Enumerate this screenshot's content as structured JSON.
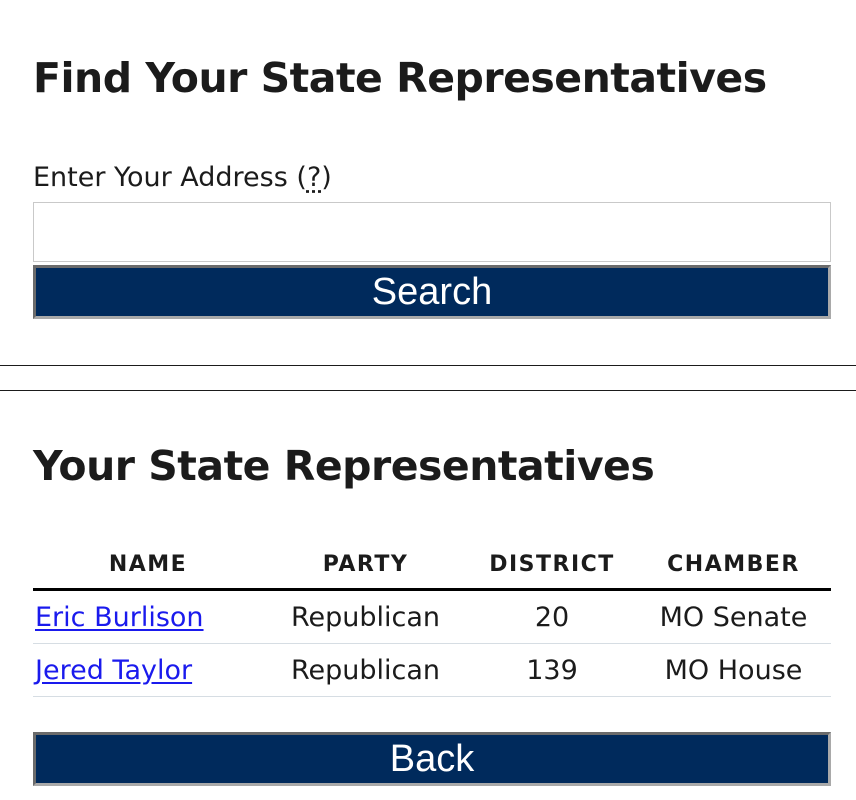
{
  "find": {
    "title": "Find Your State Representatives",
    "address_label_text": "Enter Your Address ",
    "address_help_open": "(",
    "address_help_mark": "?",
    "address_help_close": ")",
    "address_value": "",
    "address_placeholder": "",
    "search_label": "Search"
  },
  "results": {
    "title": "Your State Representatives",
    "columns": [
      "NAME",
      "PARTY",
      "DISTRICT",
      "CHAMBER"
    ],
    "rows": [
      {
        "name": "Eric Burlison",
        "party": "Republican",
        "district": "20",
        "chamber": "MO Senate"
      },
      {
        "name": "Jered Taylor",
        "party": "Republican",
        "district": "139",
        "chamber": "MO House"
      }
    ],
    "back_label": "Back"
  },
  "colors": {
    "button_bg": "#002a5c",
    "link": "#1a1aed",
    "text": "#1b1b1b"
  }
}
